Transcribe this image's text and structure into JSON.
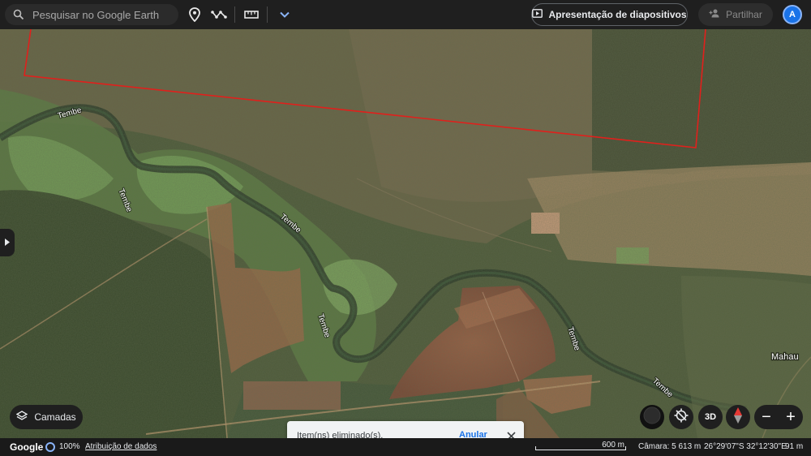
{
  "search": {
    "placeholder": "Pesquisar no Google Earth"
  },
  "toolbar": {
    "icons": [
      "location-pin-icon",
      "path-icon",
      "ruler-icon",
      "chevron-down-icon"
    ],
    "slideshow_label": "Apresentação de diapositivos",
    "share_label": "Partilhar",
    "avatar_letter": "A"
  },
  "map": {
    "river_labels": [
      "Tembe",
      "Tembe",
      "Tembe",
      "Tembe",
      "Tembe",
      "Tembe"
    ],
    "place_labels": [
      "Mahau"
    ],
    "polygon_color": "#e0201c"
  },
  "layers": {
    "label": "Camadas"
  },
  "toast": {
    "message": "Item(ns) eliminado(s).",
    "undo_label": "Anular"
  },
  "controls": {
    "label_3d": "3D",
    "zoom_in": "+",
    "zoom_out": "−"
  },
  "status": {
    "logo": "Google",
    "zoom_percent": "100%",
    "attribution": "Atribuição de dados",
    "scale": "600 m",
    "camera": "Câmara: 5 613 m",
    "coordinates": "26°29'07\"S 32°12'30\"E",
    "elevation": "91 m"
  },
  "colors": {
    "accent": "#1a73e8",
    "toast_bg": "#f1f3f4",
    "bar_bg": "#1f1f1f"
  }
}
